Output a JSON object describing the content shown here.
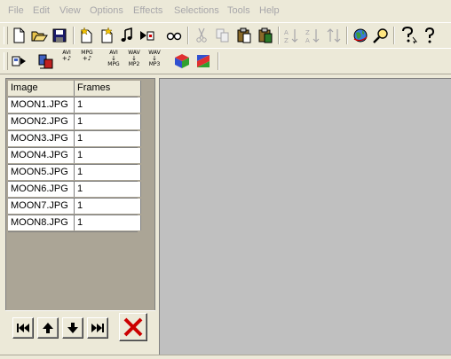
{
  "menu": {
    "file": "File",
    "edit": "Edit",
    "view": "View",
    "options": "Options",
    "effects": "Effects",
    "selections": "Selections",
    "tools": "Tools",
    "help": "Help"
  },
  "toolbar1": {
    "icons": [
      "new-icon",
      "open-icon",
      "save-icon",
      "add-image-icon",
      "add-frame-icon",
      "music-icon",
      "import-icon",
      "preview-icon",
      "cut-icon",
      "copy-icon",
      "paste-icon",
      "paste-special-icon",
      "sort-ascending-icon",
      "sort-descending-icon",
      "sort-icon",
      "globe-icon",
      "zoom-icon",
      "help-icon",
      "help-question-icon"
    ]
  },
  "toolbar2": {
    "avi_music_top": "AVI",
    "mpg_music_top": "MPG",
    "avi_mpg_top": "AVI",
    "avi_mpg_bottom": "MPG",
    "wav_mp2_top": "WAV",
    "wav_mp2_bottom": "MP2",
    "wav_mp3_top": "WAV",
    "wav_mp3_bottom": "MP3"
  },
  "table": {
    "headers": {
      "image": "Image",
      "frames": "Frames"
    },
    "rows": [
      {
        "image": "MOON1.JPG",
        "frames": "1"
      },
      {
        "image": "MOON2.JPG",
        "frames": "1"
      },
      {
        "image": "MOON3.JPG",
        "frames": "1"
      },
      {
        "image": "MOON4.JPG",
        "frames": "1"
      },
      {
        "image": "MOON5.JPG",
        "frames": "1"
      },
      {
        "image": "MOON6.JPG",
        "frames": "1"
      },
      {
        "image": "MOON7.JPG",
        "frames": "1"
      },
      {
        "image": "MOON8.JPG",
        "frames": "1"
      }
    ]
  },
  "nav": {
    "icons": [
      "first-icon",
      "up-icon",
      "down-icon",
      "last-icon",
      "delete-icon"
    ]
  },
  "colors": {
    "background": "#ece9d8",
    "panel": "#aba596",
    "preview": "#c0c0c0",
    "delete": "#cc0000",
    "menu_disabled": "#a7a6aa"
  }
}
